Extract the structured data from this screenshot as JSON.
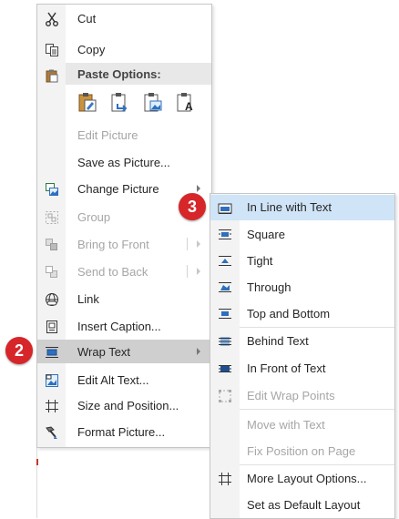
{
  "context_menu": {
    "cut": {
      "label": "Cut",
      "icon": "scissors-icon"
    },
    "copy": {
      "label": "Copy",
      "icon": "copy-icon"
    },
    "paste_options": {
      "label": "Paste Options:",
      "icon": "paste-icon"
    },
    "paste_buttons": [
      "keep-source-formatting-icon",
      "use-destination-theme-icon",
      "picture-icon",
      "keep-text-only-icon"
    ],
    "edit_picture": {
      "label": "Edit Picture",
      "disabled": true
    },
    "save_as_picture": {
      "label": "Save as Picture..."
    },
    "change_picture": {
      "label": "Change Picture"
    },
    "group": {
      "label": "Group",
      "disabled": true
    },
    "bring_to_front": {
      "label": "Bring to Front",
      "disabled": true
    },
    "send_to_back": {
      "label": "Send to Back",
      "disabled": true
    },
    "link": {
      "label": "Link"
    },
    "insert_caption": {
      "label": "Insert Caption..."
    },
    "wrap_text": {
      "label": "Wrap Text",
      "highlighted": true
    },
    "edit_alt_text": {
      "label": "Edit Alt Text..."
    },
    "size_and_position": {
      "label": "Size and Position..."
    },
    "format_picture": {
      "label": "Format Picture..."
    }
  },
  "wrap_submenu": {
    "in_line": {
      "label": "In Line with Text",
      "selected": true
    },
    "square": {
      "label": "Square"
    },
    "tight": {
      "label": "Tight"
    },
    "through": {
      "label": "Through"
    },
    "top_bottom": {
      "label": "Top and Bottom"
    },
    "behind": {
      "label": "Behind Text"
    },
    "in_front": {
      "label": "In Front of Text"
    },
    "edit_wrap_points": {
      "label": "Edit Wrap Points",
      "disabled": true
    },
    "move_with_text": {
      "label": "Move with Text",
      "disabled": true
    },
    "fix_position": {
      "label": "Fix Position on Page",
      "disabled": true
    },
    "more_layout": {
      "label": "More Layout Options..."
    },
    "set_default": {
      "label": "Set as Default Layout"
    }
  },
  "callouts": {
    "step2": "2",
    "step3": "3"
  },
  "colors": {
    "badge": "#d6262a",
    "highlight": "#cfcfcf",
    "submenu_selected": "#cfe4f7",
    "disabled_text": "#a6a6a6"
  }
}
